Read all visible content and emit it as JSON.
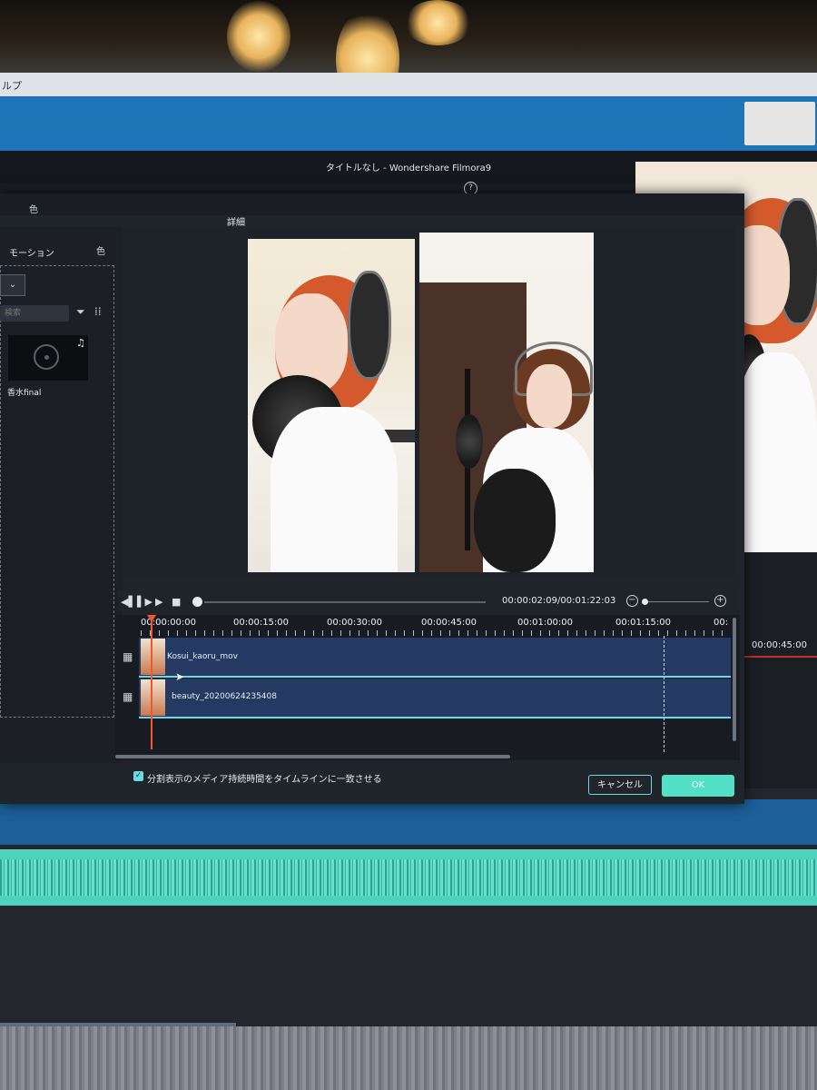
{
  "host": {
    "menubar_fragment": "ルプ",
    "window_title": "タイトルなし - Wondershare Filmora9",
    "help_icon": "question-circle-icon",
    "timeline_timecode": "00:00:45:00"
  },
  "dialog": {
    "color_tab": "色",
    "title": "詳細",
    "motion_tab": "モーション",
    "motion_tab_icon": "色",
    "dropdown_arrow": "⌄",
    "search_placeholder": "検索",
    "media_item": {
      "name": "香水final",
      "badge_icon": "music-note-icon"
    },
    "timecode": "00:00:02:09/00:01:22:03",
    "ruler": [
      "00:00:00:00",
      "00:00:15:00",
      "00:00:30:00",
      "00:00:45:00",
      "00:01:00:00",
      "00:01:15:00",
      "00:"
    ],
    "tracks": [
      {
        "label": "Kosui_kaoru_mov"
      },
      {
        "label": "beauty_20200624235408"
      }
    ],
    "checkbox_label": "分割表示のメディア持続時間をタイムラインに一致させる",
    "checkbox_checked": true,
    "cancel_label": "キャンセル",
    "ok_label": "OK"
  },
  "colors": {
    "accent": "#6fd8e6",
    "ok_button": "#53e0c7",
    "playhead": "#f0582e",
    "track": "#243a63"
  }
}
